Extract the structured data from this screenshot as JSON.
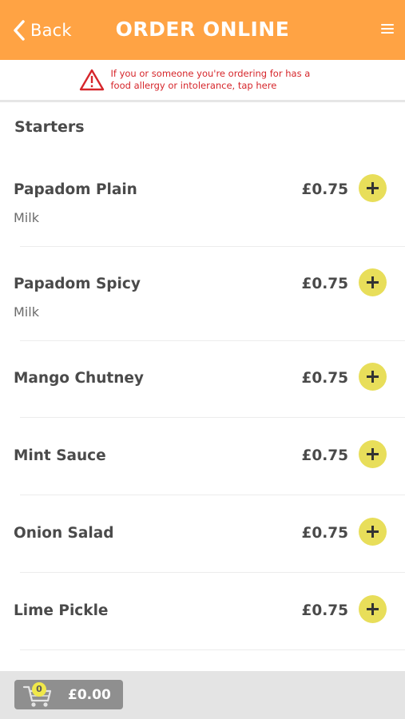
{
  "header": {
    "back_label": "Back",
    "title": "ORDER ONLINE"
  },
  "allergy_banner": {
    "text": "If you or someone you're ordering for has a food allergy or intolerance, tap here"
  },
  "section": {
    "title": "Starters"
  },
  "items": [
    {
      "name": "Papadom Plain",
      "price": "£0.75",
      "allergen": "Milk"
    },
    {
      "name": "Papadom Spicy",
      "price": "£0.75",
      "allergen": "Milk"
    },
    {
      "name": "Mango Chutney",
      "price": "£0.75"
    },
    {
      "name": "Mint Sauce",
      "price": "£0.75"
    },
    {
      "name": "Onion Salad",
      "price": "£0.75"
    },
    {
      "name": "Lime Pickle",
      "price": "£0.75"
    }
  ],
  "basket": {
    "count": "0",
    "total": "£0.00"
  },
  "colors": {
    "header": "#ffa344",
    "add_button": "#e8de5a",
    "allergy_text": "#d6262b",
    "basket": "#8f8f8f"
  },
  "icons": {
    "back": "chevron-left-icon",
    "menu": "hamburger-menu-icon",
    "allergy": "warning-triangle-icon",
    "add": "plus-icon",
    "cart": "shopping-cart-icon"
  }
}
